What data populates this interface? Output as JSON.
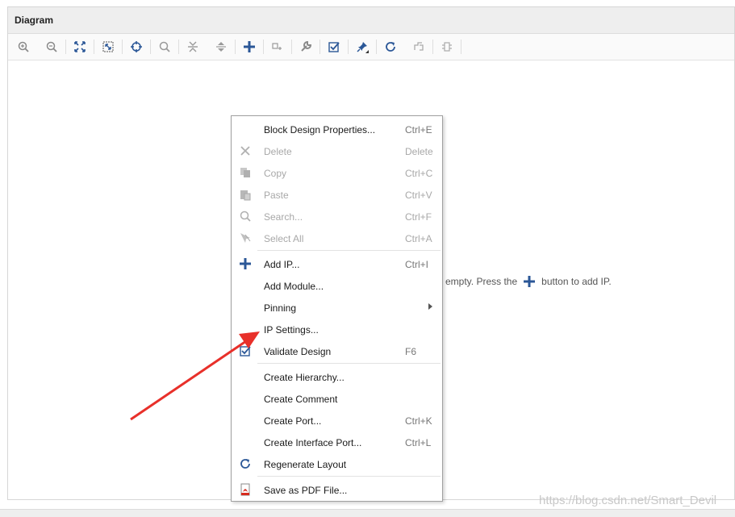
{
  "panel": {
    "title": "Diagram"
  },
  "toolbar": {
    "buttons": [
      "zoom-in-icon",
      "zoom-out-icon",
      "zoom-fit-icon",
      "zoom-area-icon",
      "center-target-icon",
      "search-icon",
      "collapse-icon",
      "expand-icon",
      "add-ip-icon",
      "add-module-icon",
      "properties-wrench-icon",
      "validate-icon",
      "pin-icon",
      "refresh-icon",
      "regenerate-icon",
      "port-icon"
    ]
  },
  "canvas": {
    "empty_text_before": "n is empty. Press the",
    "empty_text_after": "button to add IP."
  },
  "context_menu": {
    "items": [
      {
        "label": "Block Design Properties...",
        "shortcut": "Ctrl+E",
        "icon": "",
        "disabled": false
      },
      {
        "label": "Delete",
        "shortcut": "Delete",
        "icon": "delete-x-icon",
        "disabled": true
      },
      {
        "label": "Copy",
        "shortcut": "Ctrl+C",
        "icon": "copy-icon",
        "disabled": true
      },
      {
        "label": "Paste",
        "shortcut": "Ctrl+V",
        "icon": "paste-icon",
        "disabled": true
      },
      {
        "label": "Search...",
        "shortcut": "Ctrl+F",
        "icon": "search-icon",
        "disabled": true
      },
      {
        "label": "Select All",
        "shortcut": "Ctrl+A",
        "icon": "select-all-icon",
        "disabled": true
      },
      {
        "label": "Add IP...",
        "shortcut": "Ctrl+I",
        "icon": "plus-icon",
        "disabled": false
      },
      {
        "label": "Add Module...",
        "shortcut": "",
        "icon": "",
        "disabled": false
      },
      {
        "label": "Pinning",
        "shortcut": "",
        "icon": "",
        "disabled": false,
        "submenu": true
      },
      {
        "label": "IP Settings...",
        "shortcut": "",
        "icon": "",
        "disabled": false
      },
      {
        "label": "Validate Design",
        "shortcut": "F6",
        "icon": "validate-check-icon",
        "disabled": false
      },
      {
        "label": "Create Hierarchy...",
        "shortcut": "",
        "icon": "",
        "disabled": false
      },
      {
        "label": "Create Comment",
        "shortcut": "",
        "icon": "",
        "disabled": false
      },
      {
        "label": "Create Port...",
        "shortcut": "Ctrl+K",
        "icon": "",
        "disabled": false
      },
      {
        "label": "Create Interface Port...",
        "shortcut": "Ctrl+L",
        "icon": "",
        "disabled": false
      },
      {
        "label": "Regenerate Layout",
        "shortcut": "",
        "icon": "regenerate-icon",
        "disabled": false
      },
      {
        "label": "Save as PDF File...",
        "shortcut": "",
        "icon": "pdf-icon",
        "disabled": false
      }
    ]
  },
  "watermark": "https://blog.csdn.net/Smart_Devil",
  "colors": {
    "accent_blue": "#2b5797",
    "annotation_red": "#e8302a",
    "disabled_text": "#a8a8a8"
  }
}
